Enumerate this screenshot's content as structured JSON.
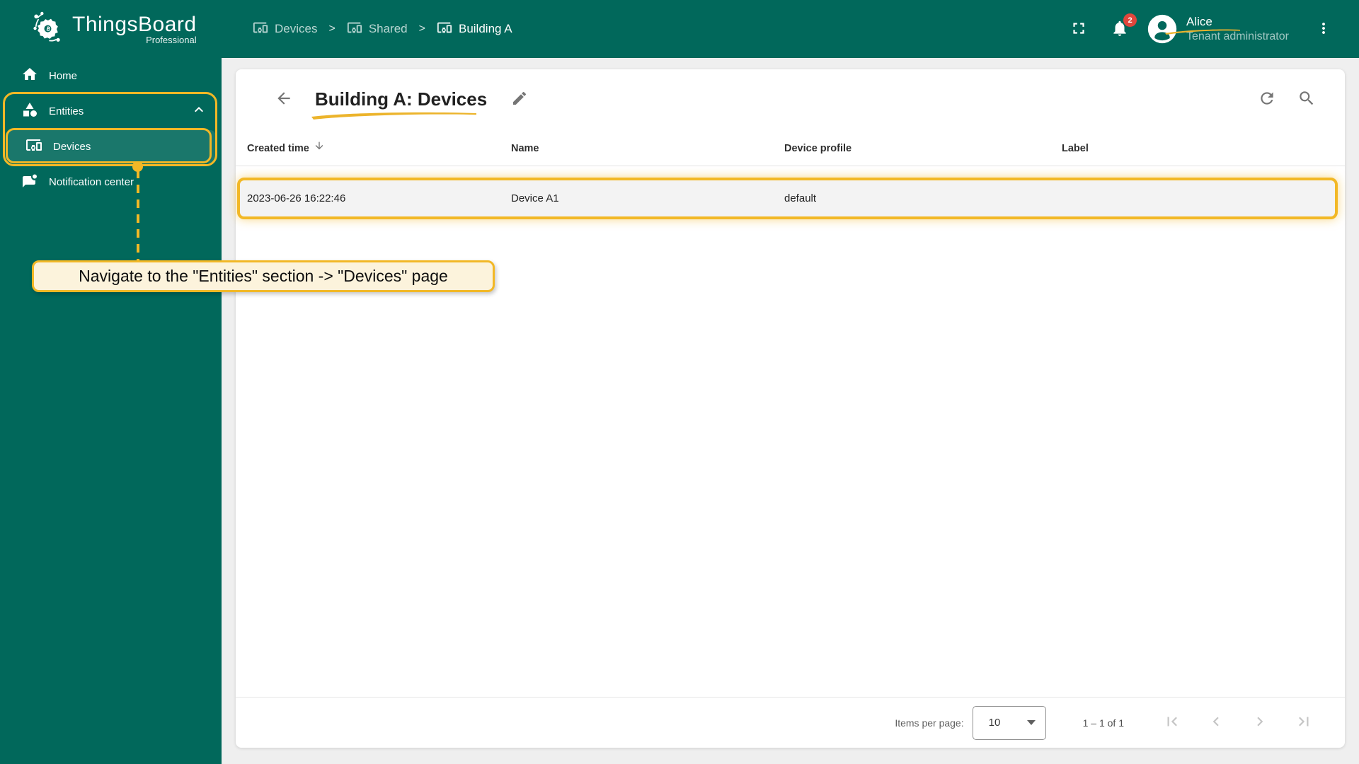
{
  "header": {
    "logo_title": "ThingsBoard",
    "logo_subtitle": "Professional",
    "breadcrumb_separator": ">",
    "breadcrumbs": [
      {
        "label": "Devices"
      },
      {
        "label": "Shared"
      },
      {
        "label": "Building A"
      }
    ],
    "notification_count": "2",
    "user": {
      "name": "Alice",
      "role": "Tenant administrator"
    }
  },
  "sidebar": {
    "items": [
      {
        "label": "Home"
      },
      {
        "label": "Entities"
      },
      {
        "label": "Devices"
      },
      {
        "label": "Notification center"
      }
    ]
  },
  "annotation": {
    "tooltip_text": "Navigate to the \"Entities\" section -> \"Devices\" page"
  },
  "main": {
    "title": "Building A: Devices",
    "table": {
      "columns": [
        "Created time",
        "Name",
        "Device profile",
        "Label"
      ],
      "sort_column": "Created time",
      "sort_direction": "desc",
      "rows": [
        [
          "2023-06-26 16:22:46",
          "Device A1",
          "default",
          ""
        ]
      ]
    },
    "pagination": {
      "items_per_page_label": "Items per page:",
      "items_per_page_value": "10",
      "range_label": "1 – 1 of 1"
    }
  },
  "colors": {
    "brand_teal": "#01685B",
    "annotation_yellow": "#F2B826",
    "tooltip_bg": "#FCF3DC",
    "badge_red": "#E0463C",
    "content_bg": "#EFEFEF"
  }
}
